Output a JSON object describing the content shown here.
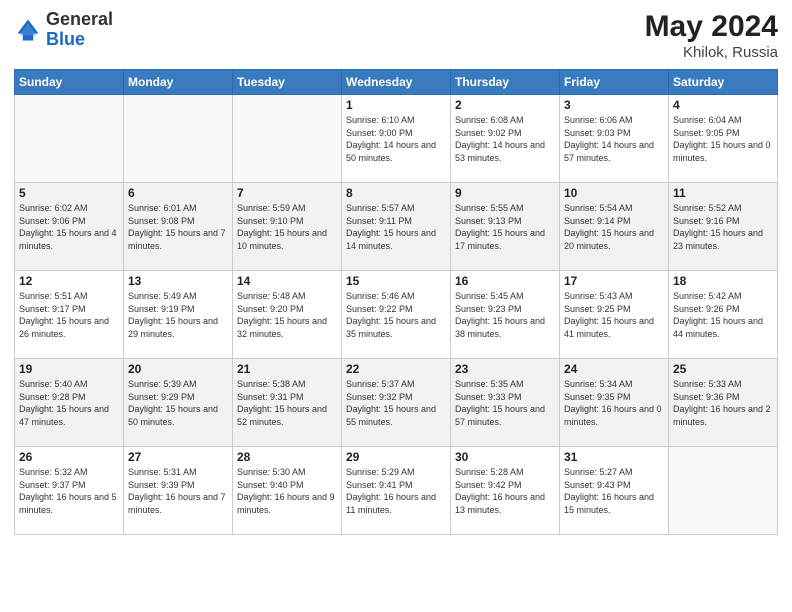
{
  "header": {
    "logo_general": "General",
    "logo_blue": "Blue",
    "title": "May 2024",
    "location": "Khilok, Russia"
  },
  "weekdays": [
    "Sunday",
    "Monday",
    "Tuesday",
    "Wednesday",
    "Thursday",
    "Friday",
    "Saturday"
  ],
  "weeks": [
    [
      {
        "day": "",
        "empty": true
      },
      {
        "day": "",
        "empty": true
      },
      {
        "day": "",
        "empty": true
      },
      {
        "day": "1",
        "sunrise": "Sunrise: 6:10 AM",
        "sunset": "Sunset: 9:00 PM",
        "daylight": "Daylight: 14 hours and 50 minutes."
      },
      {
        "day": "2",
        "sunrise": "Sunrise: 6:08 AM",
        "sunset": "Sunset: 9:02 PM",
        "daylight": "Daylight: 14 hours and 53 minutes."
      },
      {
        "day": "3",
        "sunrise": "Sunrise: 6:06 AM",
        "sunset": "Sunset: 9:03 PM",
        "daylight": "Daylight: 14 hours and 57 minutes."
      },
      {
        "day": "4",
        "sunrise": "Sunrise: 6:04 AM",
        "sunset": "Sunset: 9:05 PM",
        "daylight": "Daylight: 15 hours and 0 minutes."
      }
    ],
    [
      {
        "day": "5",
        "sunrise": "Sunrise: 6:02 AM",
        "sunset": "Sunset: 9:06 PM",
        "daylight": "Daylight: 15 hours and 4 minutes."
      },
      {
        "day": "6",
        "sunrise": "Sunrise: 6:01 AM",
        "sunset": "Sunset: 9:08 PM",
        "daylight": "Daylight: 15 hours and 7 minutes."
      },
      {
        "day": "7",
        "sunrise": "Sunrise: 5:59 AM",
        "sunset": "Sunset: 9:10 PM",
        "daylight": "Daylight: 15 hours and 10 minutes."
      },
      {
        "day": "8",
        "sunrise": "Sunrise: 5:57 AM",
        "sunset": "Sunset: 9:11 PM",
        "daylight": "Daylight: 15 hours and 14 minutes."
      },
      {
        "day": "9",
        "sunrise": "Sunrise: 5:55 AM",
        "sunset": "Sunset: 9:13 PM",
        "daylight": "Daylight: 15 hours and 17 minutes."
      },
      {
        "day": "10",
        "sunrise": "Sunrise: 5:54 AM",
        "sunset": "Sunset: 9:14 PM",
        "daylight": "Daylight: 15 hours and 20 minutes."
      },
      {
        "day": "11",
        "sunrise": "Sunrise: 5:52 AM",
        "sunset": "Sunset: 9:16 PM",
        "daylight": "Daylight: 15 hours and 23 minutes."
      }
    ],
    [
      {
        "day": "12",
        "sunrise": "Sunrise: 5:51 AM",
        "sunset": "Sunset: 9:17 PM",
        "daylight": "Daylight: 15 hours and 26 minutes."
      },
      {
        "day": "13",
        "sunrise": "Sunrise: 5:49 AM",
        "sunset": "Sunset: 9:19 PM",
        "daylight": "Daylight: 15 hours and 29 minutes."
      },
      {
        "day": "14",
        "sunrise": "Sunrise: 5:48 AM",
        "sunset": "Sunset: 9:20 PM",
        "daylight": "Daylight: 15 hours and 32 minutes."
      },
      {
        "day": "15",
        "sunrise": "Sunrise: 5:46 AM",
        "sunset": "Sunset: 9:22 PM",
        "daylight": "Daylight: 15 hours and 35 minutes."
      },
      {
        "day": "16",
        "sunrise": "Sunrise: 5:45 AM",
        "sunset": "Sunset: 9:23 PM",
        "daylight": "Daylight: 15 hours and 38 minutes."
      },
      {
        "day": "17",
        "sunrise": "Sunrise: 5:43 AM",
        "sunset": "Sunset: 9:25 PM",
        "daylight": "Daylight: 15 hours and 41 minutes."
      },
      {
        "day": "18",
        "sunrise": "Sunrise: 5:42 AM",
        "sunset": "Sunset: 9:26 PM",
        "daylight": "Daylight: 15 hours and 44 minutes."
      }
    ],
    [
      {
        "day": "19",
        "sunrise": "Sunrise: 5:40 AM",
        "sunset": "Sunset: 9:28 PM",
        "daylight": "Daylight: 15 hours and 47 minutes."
      },
      {
        "day": "20",
        "sunrise": "Sunrise: 5:39 AM",
        "sunset": "Sunset: 9:29 PM",
        "daylight": "Daylight: 15 hours and 50 minutes."
      },
      {
        "day": "21",
        "sunrise": "Sunrise: 5:38 AM",
        "sunset": "Sunset: 9:31 PM",
        "daylight": "Daylight: 15 hours and 52 minutes."
      },
      {
        "day": "22",
        "sunrise": "Sunrise: 5:37 AM",
        "sunset": "Sunset: 9:32 PM",
        "daylight": "Daylight: 15 hours and 55 minutes."
      },
      {
        "day": "23",
        "sunrise": "Sunrise: 5:35 AM",
        "sunset": "Sunset: 9:33 PM",
        "daylight": "Daylight: 15 hours and 57 minutes."
      },
      {
        "day": "24",
        "sunrise": "Sunrise: 5:34 AM",
        "sunset": "Sunset: 9:35 PM",
        "daylight": "Daylight: 16 hours and 0 minutes."
      },
      {
        "day": "25",
        "sunrise": "Sunrise: 5:33 AM",
        "sunset": "Sunset: 9:36 PM",
        "daylight": "Daylight: 16 hours and 2 minutes."
      }
    ],
    [
      {
        "day": "26",
        "sunrise": "Sunrise: 5:32 AM",
        "sunset": "Sunset: 9:37 PM",
        "daylight": "Daylight: 16 hours and 5 minutes."
      },
      {
        "day": "27",
        "sunrise": "Sunrise: 5:31 AM",
        "sunset": "Sunset: 9:39 PM",
        "daylight": "Daylight: 16 hours and 7 minutes."
      },
      {
        "day": "28",
        "sunrise": "Sunrise: 5:30 AM",
        "sunset": "Sunset: 9:40 PM",
        "daylight": "Daylight: 16 hours and 9 minutes."
      },
      {
        "day": "29",
        "sunrise": "Sunrise: 5:29 AM",
        "sunset": "Sunset: 9:41 PM",
        "daylight": "Daylight: 16 hours and 11 minutes."
      },
      {
        "day": "30",
        "sunrise": "Sunrise: 5:28 AM",
        "sunset": "Sunset: 9:42 PM",
        "daylight": "Daylight: 16 hours and 13 minutes."
      },
      {
        "day": "31",
        "sunrise": "Sunrise: 5:27 AM",
        "sunset": "Sunset: 9:43 PM",
        "daylight": "Daylight: 16 hours and 15 minutes."
      },
      {
        "day": "",
        "empty": true
      }
    ]
  ]
}
